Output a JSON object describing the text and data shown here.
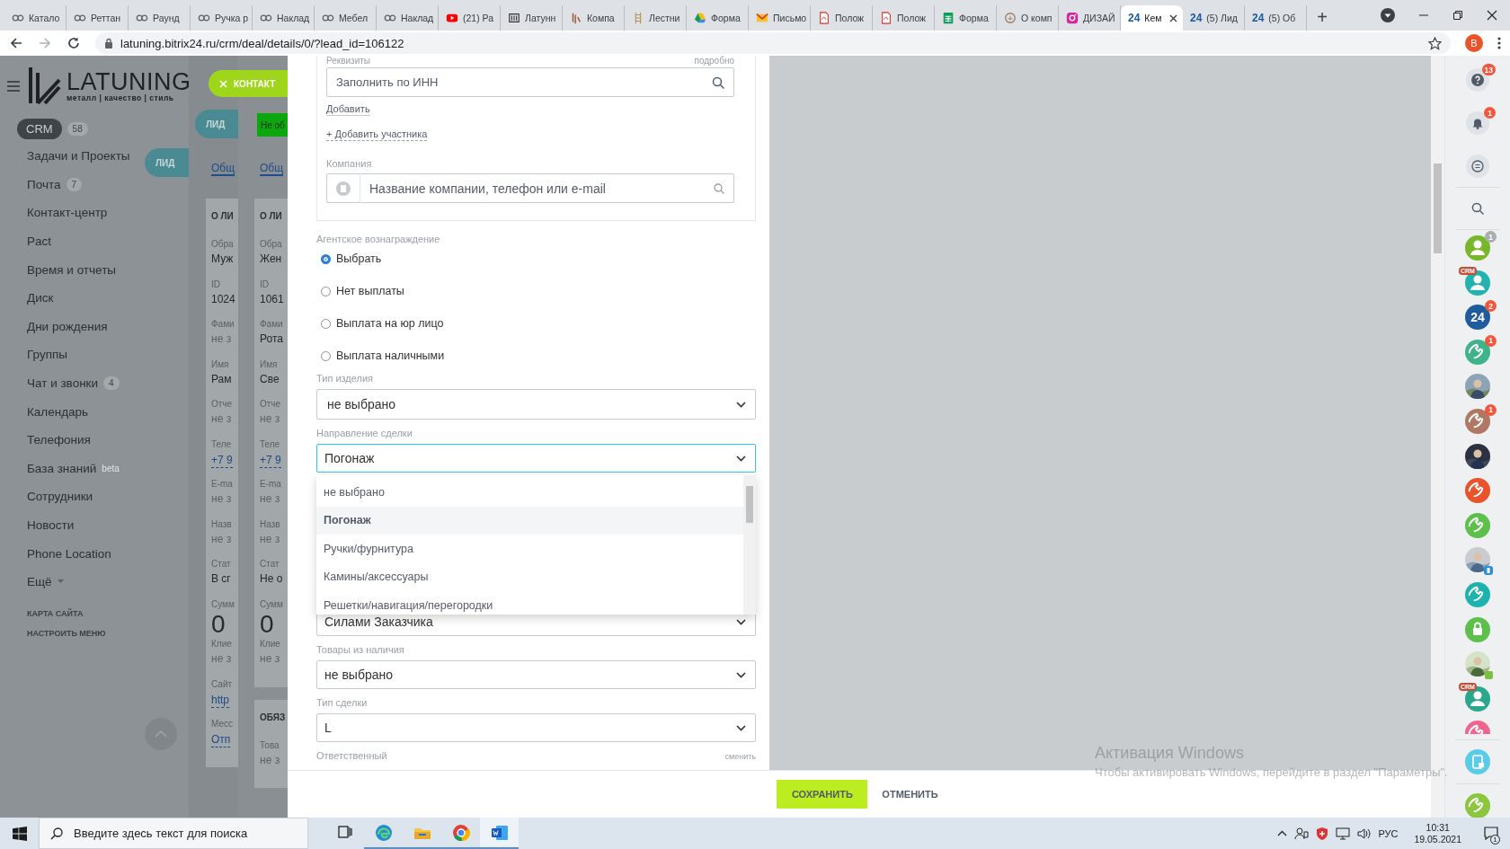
{
  "browser": {
    "tabs": [
      {
        "kind": "loops",
        "label": "Катало",
        "selected": false
      },
      {
        "kind": "loops",
        "label": "Реттан",
        "selected": false
      },
      {
        "kind": "loops",
        "label": "Раунд",
        "selected": false
      },
      {
        "kind": "loops",
        "label": "Ручка р",
        "selected": false
      },
      {
        "kind": "loops",
        "label": "Наклад",
        "selected": false
      },
      {
        "kind": "loops",
        "label": "Мебел",
        "selected": false
      },
      {
        "kind": "loops",
        "label": "Наклад",
        "selected": false
      },
      {
        "kind": "play",
        "label": "(21) Ра",
        "selected": false
      },
      {
        "kind": "box",
        "label": "Латунн",
        "selected": false
      },
      {
        "kind": "stripes",
        "label": "Компа",
        "selected": false
      },
      {
        "kind": "ladder",
        "label": "Лестни",
        "selected": false
      },
      {
        "kind": "triangle",
        "label": "Форма",
        "selected": false
      },
      {
        "kind": "envelope",
        "label": "Письмо",
        "selected": false
      },
      {
        "kind": "document",
        "label": "Полож",
        "selected": false
      },
      {
        "kind": "document",
        "label": "Полож",
        "selected": false
      },
      {
        "kind": "sheet",
        "label": "Форма",
        "selected": false
      },
      {
        "kind": "ring",
        "label": "О комп",
        "selected": false
      },
      {
        "kind": "camera",
        "label": "ДИЗАЙ",
        "selected": false
      },
      {
        "kind": "logo",
        "logo_text": "24",
        "label": "Кем",
        "selected": true
      },
      {
        "kind": "logo",
        "logo_text": "24",
        "label": "(5) Лид",
        "selected": false
      },
      {
        "kind": "logo",
        "logo_text": "24",
        "label": "(5) Об",
        "selected": false
      }
    ],
    "new_tab": "+",
    "url": "latuning.bitrix24.ru/crm/deal/details/0/?lead_id=106122",
    "profile": "В"
  },
  "sidebar": {
    "logo": {
      "name": "LATUNING",
      "tagline": "металл | качество | стиль"
    },
    "items": [
      {
        "label": "CRM",
        "selected": true,
        "counter": "58"
      },
      {
        "label": "Задачи и Проекты",
        "selected": false
      },
      {
        "label": "Почта",
        "selected": false,
        "counter": "7"
      },
      {
        "label": "Контакт-центр",
        "selected": false
      },
      {
        "label": "Pact",
        "selected": false
      },
      {
        "label": "Время и отчеты",
        "selected": false
      },
      {
        "label": "Диск",
        "selected": false
      },
      {
        "label": "Дни рождения",
        "selected": false
      },
      {
        "label": "Группы",
        "selected": false
      },
      {
        "label": "Чат и звонки",
        "selected": false,
        "counter": "4"
      },
      {
        "label": "Календарь",
        "selected": false
      },
      {
        "label": "Телефония",
        "selected": false
      },
      {
        "label": "База знаний",
        "selected": false,
        "sup": "beta"
      },
      {
        "label": "Сотрудники",
        "selected": false
      },
      {
        "label": "Новости",
        "selected": false
      },
      {
        "label": "Phone Location",
        "selected": false
      },
      {
        "label": "Ещё",
        "selected": false,
        "caret": true
      }
    ],
    "footer_links": [
      "КАРТА САЙТА",
      "НАСТРОИТЬ МЕНЮ"
    ]
  },
  "background_sliders": [
    {
      "label": "ЛИД",
      "tab": "Общ",
      "sections": [
        {
          "title": "О ЛИ",
          "fields": [
            {
              "label": "Обра",
              "value": "Муж",
              "kind": "value"
            },
            {
              "label": "ID",
              "value": "1024",
              "kind": "value"
            },
            {
              "label": "Фами",
              "value": "не з",
              "kind": "empty"
            },
            {
              "label": "Имя",
              "value": "Рам",
              "kind": "value"
            },
            {
              "label": "Отче",
              "value": "не з",
              "kind": "empty"
            },
            {
              "label": "Теле",
              "value": "+7 9",
              "kind": "link"
            },
            {
              "label": "E-ma",
              "value": "не з",
              "kind": "empty"
            },
            {
              "label": "Назв",
              "value": "не з",
              "kind": "empty"
            },
            {
              "label": "Стат",
              "value": "В сг",
              "kind": "value"
            },
            {
              "label": "Сумм",
              "value": "0",
              "kind": "sum"
            },
            {
              "label": "Клие",
              "value": "не з",
              "kind": "empty"
            },
            {
              "label": "Сайт",
              "value": "http",
              "kind": "link"
            },
            {
              "label": "Месс",
              "value": "Отп",
              "kind": "link"
            }
          ]
        }
      ]
    },
    {
      "label": "ЛИД",
      "status": "Не об",
      "tab": "Общ",
      "sections": [
        {
          "title": "О ЛИ",
          "fields": [
            {
              "label": "Обра",
              "value": "Жен",
              "kind": "value"
            },
            {
              "label": "ID",
              "value": "1061",
              "kind": "value"
            },
            {
              "label": "Фами",
              "value": "Рота",
              "kind": "value"
            },
            {
              "label": "Имя",
              "value": "Све",
              "kind": "value"
            },
            {
              "label": "Отче",
              "value": "не з",
              "kind": "empty"
            },
            {
              "label": "Теле",
              "value": "+7 9",
              "kind": "link"
            },
            {
              "label": "E-ma",
              "value": "не з",
              "kind": "empty"
            },
            {
              "label": "Назв",
              "value": "не з",
              "kind": "empty"
            },
            {
              "label": "Стат",
              "value": "Не о",
              "kind": "value"
            },
            {
              "label": "Сумм",
              "value": "0",
              "kind": "sum"
            },
            {
              "label": "Клие",
              "value": "не з",
              "kind": "empty"
            }
          ]
        },
        {
          "title": "ОБЯЗ",
          "fields": [
            {
              "label": "Това",
              "value": "не з",
              "kind": "empty"
            }
          ]
        }
      ]
    }
  ],
  "slider": {
    "tag": "КОНТАКТ",
    "requisites": {
      "label": "Реквизиты",
      "detail_link": "подробно",
      "inn_placeholder": "Заполнить по ИНН",
      "add_link": "Добавить"
    },
    "add_participant": "+ Добавить участника",
    "company": {
      "label": "Компания",
      "placeholder": "Название компании, телефон или e-mail"
    },
    "agent_reward": {
      "label": "Агентское вознаграждение",
      "options": [
        {
          "label": "Выбрать",
          "selected": true
        },
        {
          "label": "Нет выплаты",
          "selected": false
        },
        {
          "label": "Выплата на юр лицо",
          "selected": false
        },
        {
          "label": "Выплата наличными",
          "selected": false
        }
      ]
    },
    "fields": [
      {
        "kind": "select",
        "label": "Тип изделия",
        "value": "не выбрано",
        "focused": false
      },
      {
        "kind": "select",
        "label": "Направление сделки",
        "value": "Погонаж",
        "focused": true,
        "dropdown": [
          {
            "label": "не выбрано",
            "selected": false
          },
          {
            "label": "Погонаж",
            "selected": true
          },
          {
            "label": "Ручки/фурнитура",
            "selected": false
          },
          {
            "label": "Камины/аксессуары",
            "selected": false
          },
          {
            "label": "Решетки/навигация/перегородки",
            "selected": false
          }
        ]
      },
      {
        "kind": "select",
        "value": "Силами Заказчика",
        "focused": false
      },
      {
        "kind": "select",
        "label": "Товары из наличия",
        "value": "не выбрано",
        "focused": false
      },
      {
        "kind": "select",
        "label": "Тип сделки",
        "value": "L",
        "focused": false
      },
      {
        "kind": "user",
        "label": "Ответственный",
        "action": "сменить"
      }
    ],
    "buttons": [
      {
        "label": "СОХРАНИТЬ",
        "kind": "primary"
      },
      {
        "label": "ОТМЕНИТЬ",
        "kind": "link"
      }
    ]
  },
  "os_notice": {
    "title": "Активация Windows",
    "text": "Чтобы активировать Windows, перейдите в раздел \"Параметры\"."
  },
  "rightbar": {
    "tools": [
      {
        "kind": "help",
        "badge": "13"
      },
      {
        "kind": "bell",
        "badge": "1"
      },
      {
        "kind": "chat"
      },
      {
        "kind": "search"
      }
    ],
    "contacts": [
      {
        "kind": "user",
        "color": "#78b62a",
        "badge": "1",
        "badge_muted": true
      },
      {
        "kind": "user",
        "color": "#22b3b0",
        "tag": "CRM"
      },
      {
        "kind": "logo",
        "color": "#1f5c9e",
        "text": "24",
        "badge": "2",
        "badge_muted": false
      },
      {
        "kind": "phone",
        "color": "#3fb38a",
        "badge": "1",
        "badge_muted": false
      },
      {
        "kind": "picture"
      },
      {
        "kind": "phone",
        "color": "#b07862",
        "badge": "1",
        "badge_muted": false
      },
      {
        "kind": "picture"
      },
      {
        "kind": "phone",
        "color": "#e9542c"
      },
      {
        "kind": "phone",
        "color": "#5cc04a"
      },
      {
        "kind": "picture",
        "device": true
      },
      {
        "kind": "phone",
        "color": "#1cb2ad"
      },
      {
        "kind": "lock",
        "color": "#5cc04a"
      },
      {
        "kind": "picture",
        "online": true
      },
      {
        "kind": "user",
        "color": "#2aa88e",
        "tag": "CRM"
      },
      {
        "kind": "phone",
        "color": "#f0648e"
      }
    ],
    "bottom": [
      {
        "kind": "device",
        "color": "#5ccbe8"
      },
      {
        "kind": "phone",
        "color": "#8cc63f"
      }
    ]
  },
  "taskbar": {
    "search_placeholder": "Введите здесь текст для поиска",
    "apps": [
      {
        "kind": "taskview",
        "running": false,
        "active": false
      },
      {
        "kind": "edge",
        "running": true,
        "active": false
      },
      {
        "kind": "folder",
        "running": true,
        "active": false
      },
      {
        "kind": "chrome",
        "running": true,
        "active": false
      },
      {
        "kind": "word",
        "running": true,
        "active": true
      }
    ],
    "language": "РУС",
    "time": "10:31",
    "date": "19.05.2021",
    "notifications": "1"
  }
}
